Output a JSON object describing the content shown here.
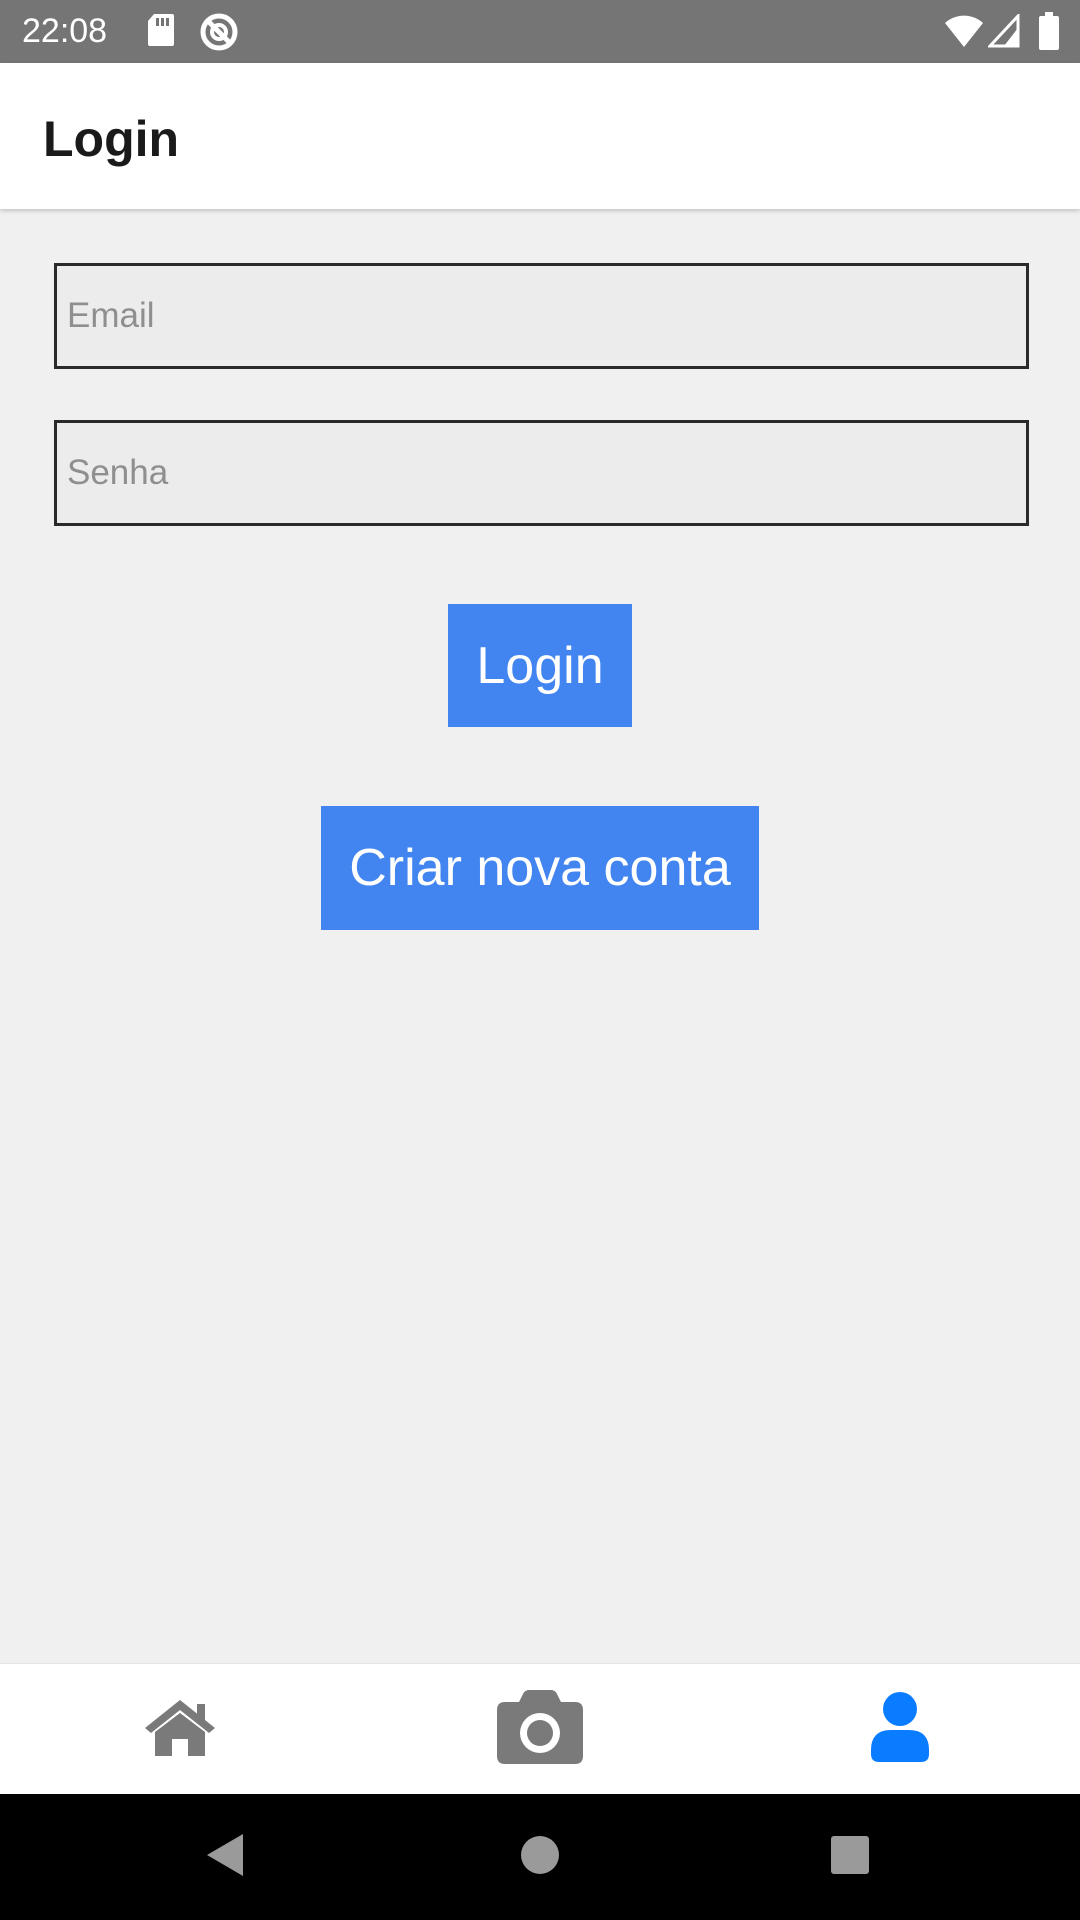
{
  "status_bar": {
    "time": "22:08",
    "left_icons": [
      "sd-card-icon",
      "sync-disabled-icon"
    ],
    "right_icons": [
      "wifi-icon",
      "cell-signal-icon",
      "battery-icon"
    ]
  },
  "app_bar": {
    "title": "Login"
  },
  "form": {
    "email_placeholder": "Email",
    "password_placeholder": "Senha",
    "login_label": "Login",
    "create_account_label": "Criar nova conta"
  },
  "tab_bar": {
    "tabs": [
      {
        "icon": "home-icon",
        "active": false
      },
      {
        "icon": "camera-icon",
        "active": false
      },
      {
        "icon": "user-icon",
        "active": true
      }
    ]
  },
  "nav_bar": {
    "buttons": [
      "back-icon",
      "home-circle-icon",
      "recents-icon"
    ]
  },
  "colors": {
    "status_bar": "#757575",
    "background": "#f0f0f0",
    "button": "#4285f0",
    "tab_inactive": "#7a7a7a",
    "tab_active": "#0a7cff"
  }
}
